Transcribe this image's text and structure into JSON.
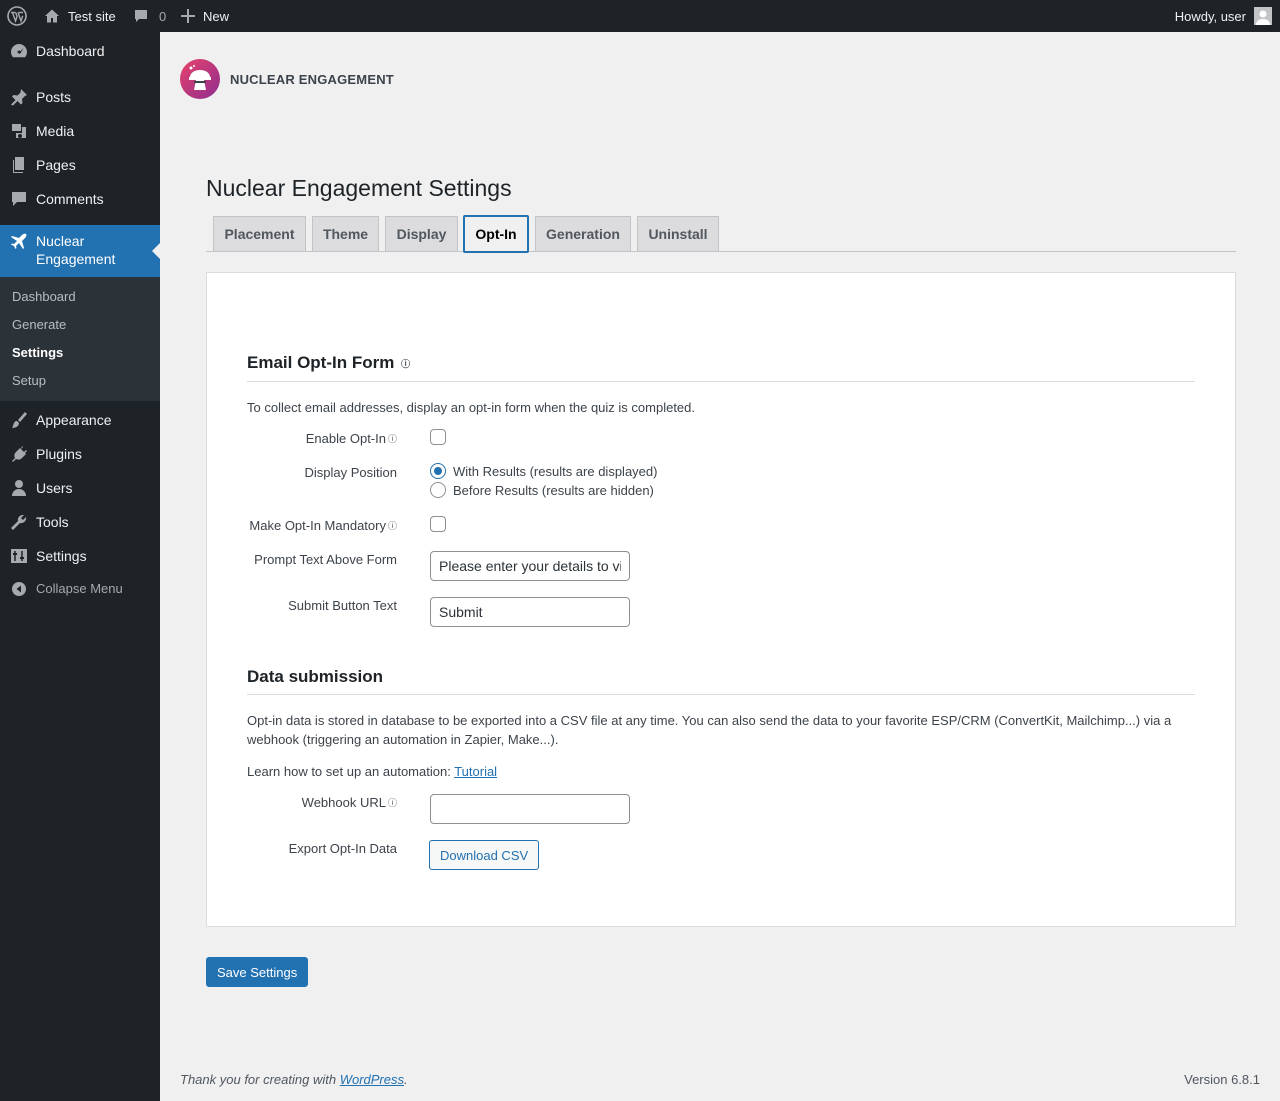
{
  "adminbar": {
    "site_name": "Test site",
    "comments_count": "0",
    "new_label": "New",
    "greeting": "Howdy, user"
  },
  "sidebar": {
    "items": [
      {
        "label": "Dashboard",
        "icon": "dashboard-icon"
      },
      {
        "label": "Posts",
        "icon": "pin-icon"
      },
      {
        "label": "Media",
        "icon": "media-icon"
      },
      {
        "label": "Pages",
        "icon": "pages-icon"
      },
      {
        "label": "Comments",
        "icon": "comment-icon"
      },
      {
        "label": "Nuclear Engagement",
        "icon": "plane-icon",
        "current": true
      },
      {
        "label": "Appearance",
        "icon": "brush-icon"
      },
      {
        "label": "Plugins",
        "icon": "plug-icon"
      },
      {
        "label": "Users",
        "icon": "user-icon"
      },
      {
        "label": "Tools",
        "icon": "wrench-icon"
      },
      {
        "label": "Settings",
        "icon": "sliders-icon"
      },
      {
        "label": "Collapse Menu",
        "icon": "collapse-icon"
      }
    ],
    "nuclear_label_line1": "Nuclear",
    "nuclear_label_line2": "Engagement",
    "submenu": [
      {
        "label": "Dashboard"
      },
      {
        "label": "Generate"
      },
      {
        "label": "Settings",
        "current": true
      },
      {
        "label": "Setup"
      }
    ]
  },
  "brand": {
    "name": "NUCLEAR ENGAGEMENT"
  },
  "page": {
    "title": "Nuclear Engagement Settings"
  },
  "tabs": [
    {
      "label": "Placement"
    },
    {
      "label": "Theme"
    },
    {
      "label": "Display"
    },
    {
      "label": "Opt-In",
      "active": true
    },
    {
      "label": "Generation"
    },
    {
      "label": "Uninstall"
    }
  ],
  "optin": {
    "heading": "Email Opt-In Form",
    "description": "To collect email addresses, display an opt-in form when the quiz is completed.",
    "enable_label": "Enable Opt-In",
    "enable_checked": false,
    "position_label": "Display Position",
    "position_options": [
      "With Results (results are displayed)",
      "Before Results (results are hidden)"
    ],
    "position_selected": "With Results (results are displayed)",
    "mandatory_label": "Make Opt-In Mandatory",
    "mandatory_checked": false,
    "prompt_label": "Prompt Text Above Form",
    "prompt_value": "Please enter your details to view",
    "submit_label": "Submit Button Text",
    "submit_value": "Submit"
  },
  "data_submission": {
    "heading": "Data submission",
    "description": "Opt-in data is stored in database to be exported into a CSV file at any time. You can also send the data to your favorite ESP/CRM (ConvertKit, Mailchimp...) via a webhook (triggering an automation in Zapier, Make...).",
    "learn_prefix": "Learn how to set up an automation:",
    "tutorial_link": "Tutorial",
    "webhook_label": "Webhook URL",
    "webhook_value": "",
    "export_label": "Export Opt-In Data",
    "download_button": "Download CSV"
  },
  "actions": {
    "save_button": "Save Settings"
  },
  "footer": {
    "thanks_prefix": "Thank you for creating with",
    "wordpress_link": "WordPress",
    "thanks_suffix": ".",
    "version": "Version 6.8.1"
  },
  "colors": {
    "admin_dark": "#1d2327",
    "accent": "#2271b1",
    "background": "#f0f0f1",
    "submenu_bg": "#2c3338"
  }
}
